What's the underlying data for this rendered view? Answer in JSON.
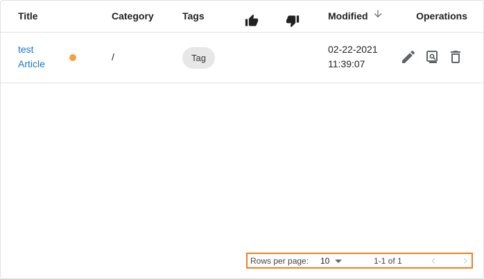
{
  "table": {
    "headers": {
      "title": "Title",
      "category": "Category",
      "tags": "Tags",
      "like_icon": "thumb-up-icon",
      "dislike_icon": "thumb-down-icon",
      "modified": "Modified",
      "modified_sort_icon": "arrow-down-icon",
      "operations": "Operations"
    },
    "rows": [
      {
        "title": "test Article",
        "status_color": "#f2a145",
        "category": "/",
        "tag": "Tag",
        "modified_date": "02-22-2021",
        "modified_time": "11:39:07",
        "operations": [
          "edit-icon",
          "preview-icon",
          "delete-icon"
        ]
      }
    ]
  },
  "pagination": {
    "rows_per_page_label": "Rows per page:",
    "rows_per_page_value": "10",
    "range": "1-1 of 1",
    "prev_icon": "chevron-left-icon",
    "next_icon": "chevron-right-icon"
  },
  "colors": {
    "link": "#1976d2",
    "highlight_border": "#f07f1e",
    "icon": "#5f6368"
  }
}
